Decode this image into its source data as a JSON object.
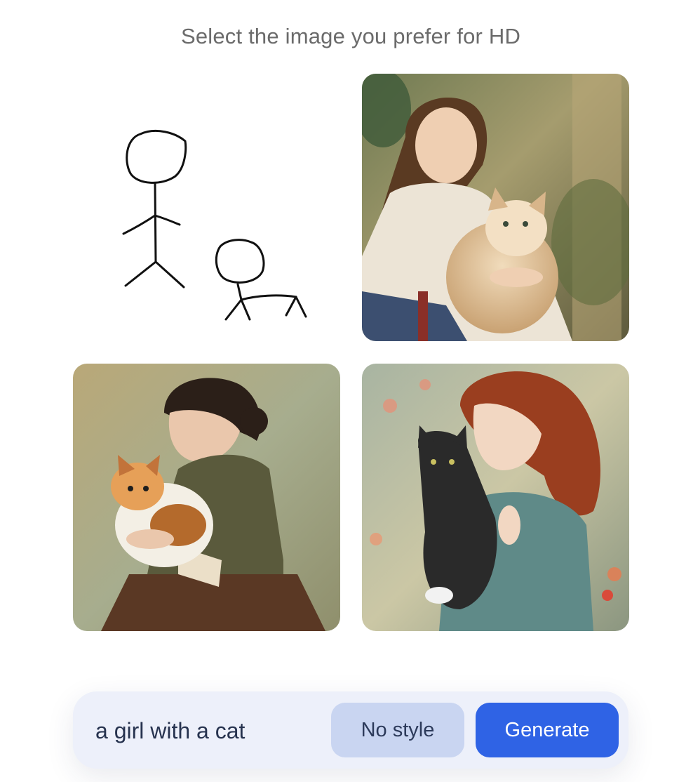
{
  "heading": "Select the image you prefer for HD",
  "images": [
    {
      "name": "stick-figure-sketch"
    },
    {
      "name": "girl-holding-cream-cat-painting"
    },
    {
      "name": "girl-holding-calico-cat-painting"
    },
    {
      "name": "redhead-girl-with-black-cat-painting"
    }
  ],
  "prompt": {
    "value": "a girl with a cat"
  },
  "buttons": {
    "style_label": "No style",
    "generate_label": "Generate"
  },
  "colors": {
    "accent": "#2f63e5",
    "style_button_bg": "#c9d5f1",
    "bar_bg": "#edf0fa"
  }
}
